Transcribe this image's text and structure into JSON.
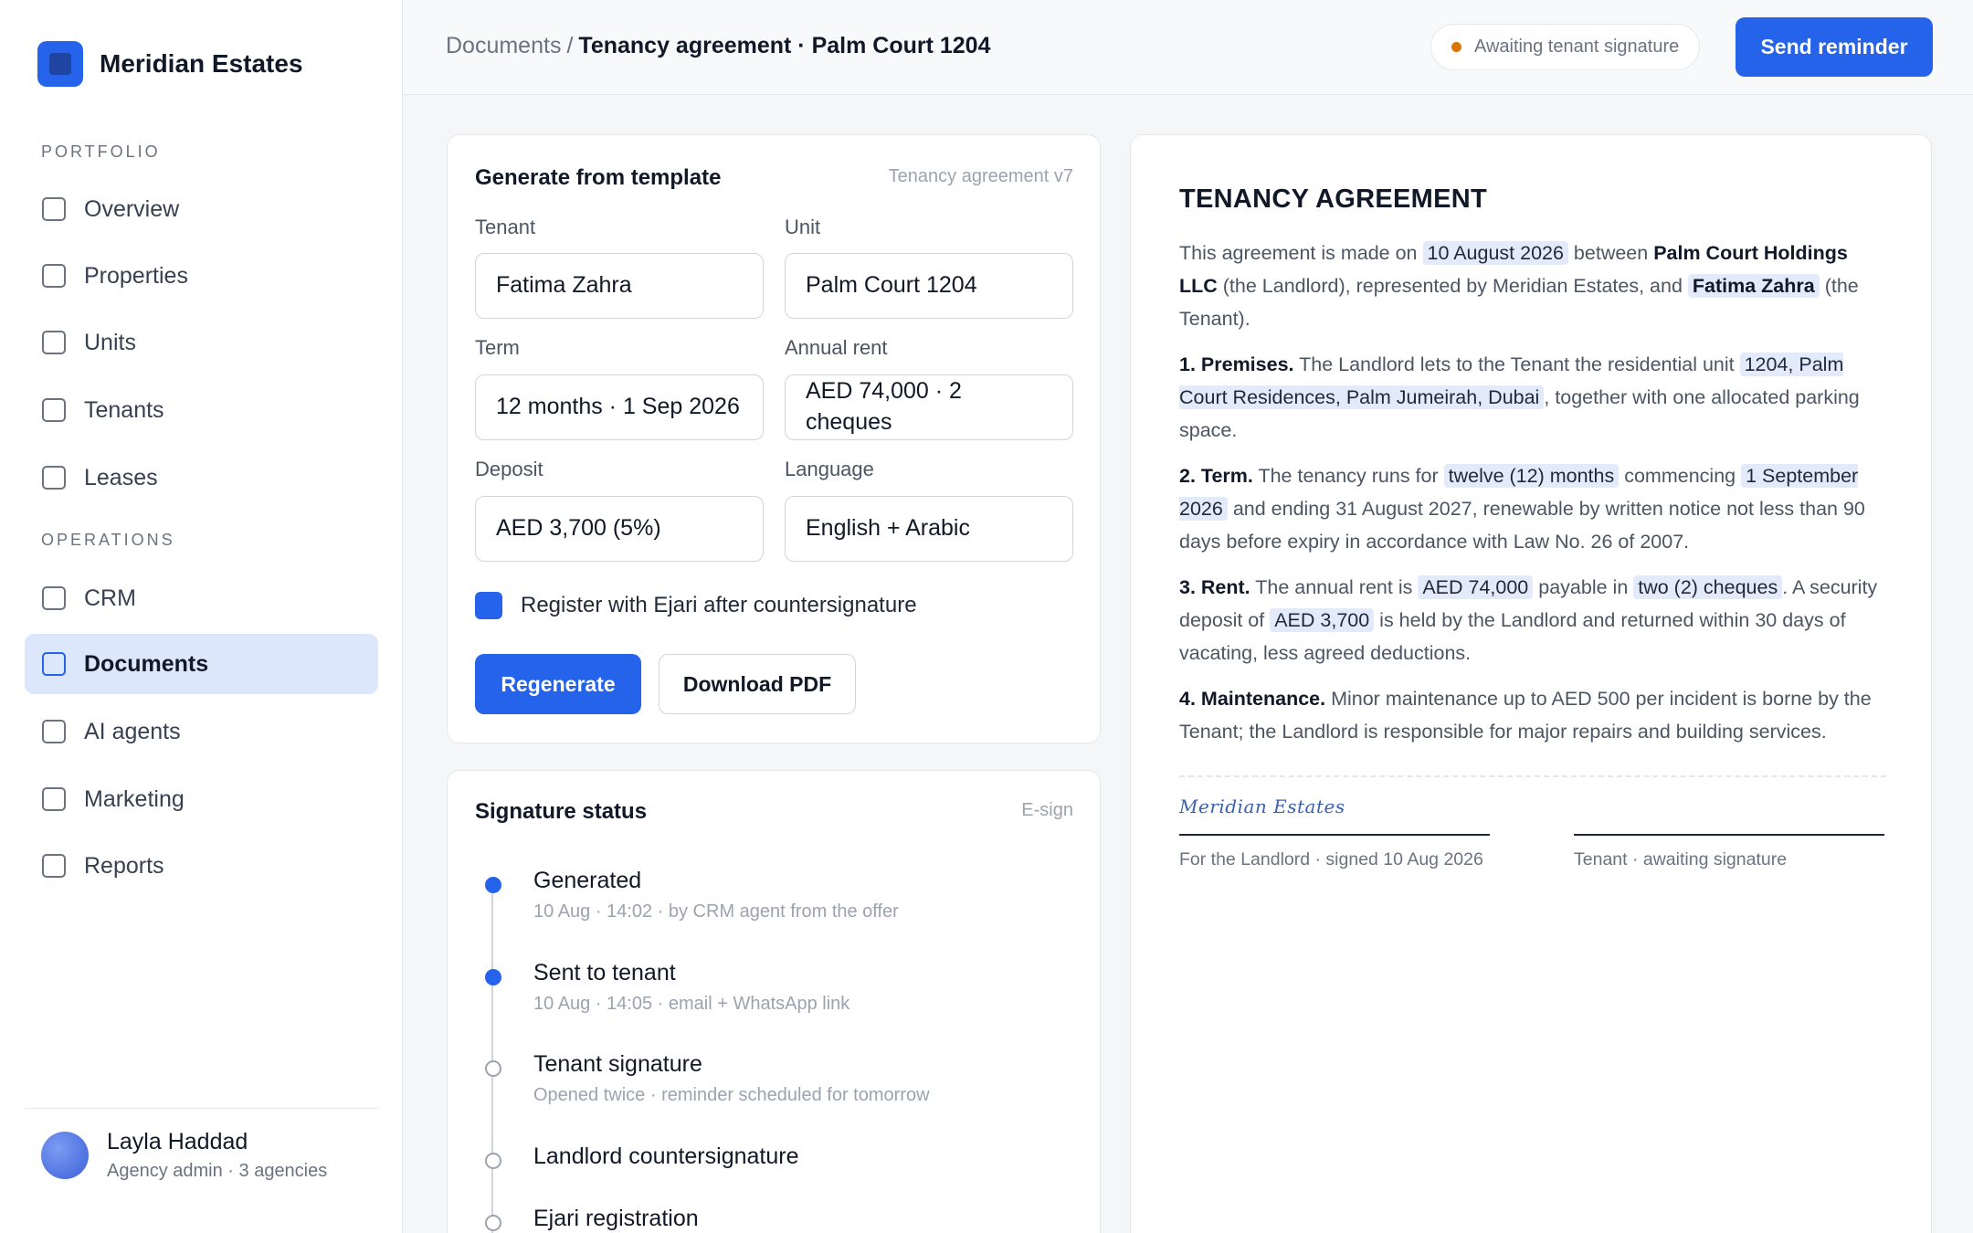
{
  "brand": {
    "name": "Meridian Estates",
    "accent": "#2563eb"
  },
  "sidebar": {
    "sections": [
      {
        "title": "PORTFOLIO",
        "items": [
          "Overview",
          "Properties",
          "Units",
          "Tenants",
          "Leases"
        ]
      },
      {
        "title": "OPERATIONS",
        "items": [
          "CRM",
          "Documents",
          "AI agents",
          "Marketing",
          "Reports"
        ]
      }
    ],
    "active_item": "Documents",
    "user": {
      "name": "Layla Haddad",
      "role": "Agency admin · 3 agencies"
    }
  },
  "header": {
    "breadcrumb_root": "Documents",
    "breadcrumb_sep": "/",
    "breadcrumb_current": "Tenancy agreement · Palm Court 1204",
    "status": "Awaiting tenant signature",
    "status_color": "#d97706",
    "send_reminder": "Send reminder"
  },
  "generate": {
    "title": "Generate from template",
    "template": "Tenancy agreement v7",
    "fields": {
      "tenant": {
        "label": "Tenant",
        "value": "Fatima Zahra"
      },
      "unit": {
        "label": "Unit",
        "value": "Palm Court 1204"
      },
      "term": {
        "label": "Term",
        "value": "12 months · 1 Sep 2026"
      },
      "rent": {
        "label": "Annual rent",
        "value": "AED 74,000 · 2 cheques"
      },
      "deposit": {
        "label": "Deposit",
        "value": "AED 3,700 (5%)"
      },
      "language": {
        "label": "Language",
        "value": "English + Arabic"
      }
    },
    "ejari_checkbox": {
      "label": "Register with Ejari after countersignature",
      "checked": true
    },
    "regenerate": "Regenerate",
    "download": "Download PDF"
  },
  "signature": {
    "title": "Signature status",
    "meta": "E-sign",
    "steps": [
      {
        "title": "Generated",
        "sub": "10 Aug · 14:02 · by CRM agent from the offer",
        "done": true
      },
      {
        "title": "Sent to tenant",
        "sub": "10 Aug · 14:05 · email + WhatsApp link",
        "done": true
      },
      {
        "title": "Tenant signature",
        "sub": "Opened twice · reminder scheduled for tomorrow",
        "done": false
      },
      {
        "title": "Landlord countersignature",
        "sub": "",
        "done": false
      },
      {
        "title": "Ejari registration",
        "sub": "",
        "done": false
      }
    ]
  },
  "document": {
    "title": "TENANCY AGREEMENT",
    "intro": {
      "t1": "This agreement is made on ",
      "date": "10 August 2026",
      "t2": " between ",
      "landlord": "Palm Court Holdings LLC",
      "t3": " (the Landlord), represented by Meridian Estates, and ",
      "tenant": "Fatima Zahra",
      "t4": " (the Tenant)."
    },
    "premises": {
      "heading": "1. Premises.",
      "t1": " The Landlord lets to the Tenant the residential unit ",
      "unit": "1204, Palm Court Residences, Palm Jumeirah, Dubai",
      "t2": ", together with one allocated parking space."
    },
    "term": {
      "heading": "2. Term.",
      "t1": " The tenancy runs for ",
      "length": "twelve (12) months",
      "t2": " commencing ",
      "start": "1 September 2026",
      "t3": " and ending 31 August 2027, renewable by written notice not less than 90 days before expiry in accordance with Law No. 26 of 2007."
    },
    "rent": {
      "heading": "3. Rent.",
      "t1": " The annual rent is ",
      "amount": "AED 74,000",
      "t2": " payable in ",
      "cheques": "two (2) cheques",
      "t3": ". A security deposit of ",
      "deposit": "AED 3,700",
      "t4": " is held by the Landlord and returned within 30 days of vacating, less agreed deductions."
    },
    "maintenance": {
      "heading": "4. Maintenance.",
      "t1": " Minor maintenance up to AED 500 per incident is borne by the Tenant; the Landlord is responsible for major repairs and building services."
    },
    "landlord_signature": "Meridian Estates",
    "landlord_caption": "For the Landlord · signed 10 Aug 2026",
    "tenant_caption": "Tenant · awaiting signature"
  }
}
